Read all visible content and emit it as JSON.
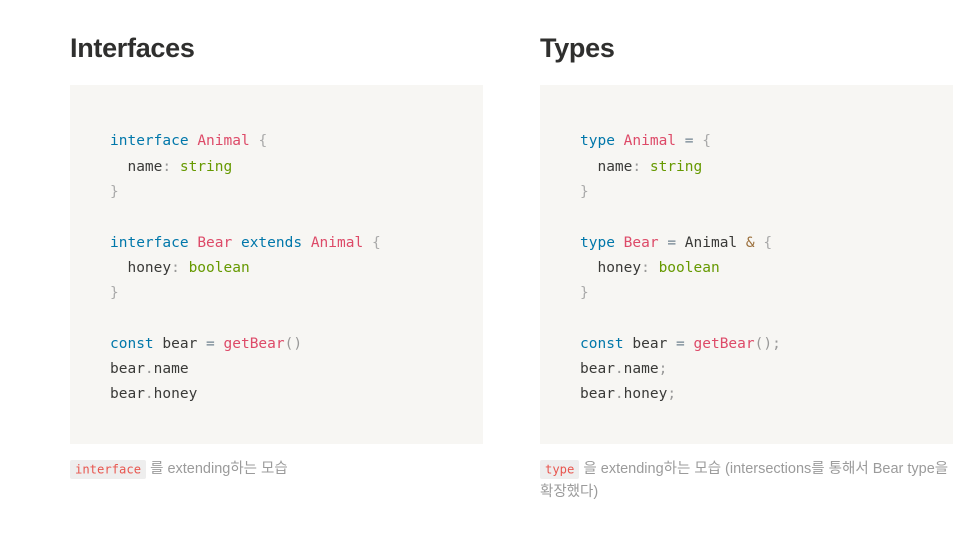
{
  "page": {
    "background": "#ffffff",
    "code_block_background": "#f7f6f3"
  },
  "colors": {
    "heading": "#2f2f2e",
    "keyword": "#0077aa",
    "type_name": "#dd4a68",
    "primitive": "#669900",
    "punctuation": "#999999",
    "operator": "#9a6e3a",
    "plain_text": "#3a3a38",
    "caption_text": "#9b9b9b",
    "chip_background": "#eeeeee",
    "chip_text": "#e8564f"
  },
  "columns": [
    {
      "id": "interfaces",
      "heading": "Interfaces",
      "code_lines": [
        {
          "tokens": [
            {
              "text": "interface",
              "cls": "t-kw"
            },
            {
              "text": " ",
              "cls": "t-plain"
            },
            {
              "text": "Animal",
              "cls": "t-type"
            },
            {
              "text": " ",
              "cls": "t-plain"
            },
            {
              "text": "{",
              "cls": "t-brace"
            }
          ]
        },
        {
          "tokens": [
            {
              "text": "  name",
              "cls": "t-plain"
            },
            {
              "text": ":",
              "cls": "t-punc"
            },
            {
              "text": " ",
              "cls": "t-plain"
            },
            {
              "text": "string",
              "cls": "t-prim"
            }
          ]
        },
        {
          "tokens": [
            {
              "text": "}",
              "cls": "t-brace"
            }
          ]
        },
        {
          "blank": true
        },
        {
          "tokens": [
            {
              "text": "interface",
              "cls": "t-kw"
            },
            {
              "text": " ",
              "cls": "t-plain"
            },
            {
              "text": "Bear",
              "cls": "t-type"
            },
            {
              "text": " ",
              "cls": "t-plain"
            },
            {
              "text": "extends",
              "cls": "t-kw"
            },
            {
              "text": " ",
              "cls": "t-plain"
            },
            {
              "text": "Animal",
              "cls": "t-type"
            },
            {
              "text": " ",
              "cls": "t-plain"
            },
            {
              "text": "{",
              "cls": "t-brace"
            }
          ]
        },
        {
          "tokens": [
            {
              "text": "  honey",
              "cls": "t-plain"
            },
            {
              "text": ":",
              "cls": "t-punc"
            },
            {
              "text": " ",
              "cls": "t-plain"
            },
            {
              "text": "boolean",
              "cls": "t-prim"
            }
          ]
        },
        {
          "tokens": [
            {
              "text": "}",
              "cls": "t-brace"
            }
          ]
        },
        {
          "blank": true
        },
        {
          "tokens": [
            {
              "text": "const",
              "cls": "t-kw"
            },
            {
              "text": " bear ",
              "cls": "t-plain"
            },
            {
              "text": "=",
              "cls": "t-eq"
            },
            {
              "text": " ",
              "cls": "t-plain"
            },
            {
              "text": "getBear",
              "cls": "t-fn"
            },
            {
              "text": "()",
              "cls": "t-punc"
            }
          ]
        },
        {
          "tokens": [
            {
              "text": "bear",
              "cls": "t-plain"
            },
            {
              "text": ".",
              "cls": "t-punc"
            },
            {
              "text": "name",
              "cls": "t-plain"
            }
          ]
        },
        {
          "tokens": [
            {
              "text": "bear",
              "cls": "t-plain"
            },
            {
              "text": ".",
              "cls": "t-punc"
            },
            {
              "text": "honey",
              "cls": "t-plain"
            }
          ]
        }
      ],
      "caption": {
        "chip": "interface",
        "text": " 를 extending하는 모습"
      }
    },
    {
      "id": "types",
      "heading": "Types",
      "code_lines": [
        {
          "tokens": [
            {
              "text": "type",
              "cls": "t-kw"
            },
            {
              "text": " ",
              "cls": "t-plain"
            },
            {
              "text": "Animal",
              "cls": "t-type"
            },
            {
              "text": " ",
              "cls": "t-plain"
            },
            {
              "text": "=",
              "cls": "t-eq"
            },
            {
              "text": " ",
              "cls": "t-plain"
            },
            {
              "text": "{",
              "cls": "t-brace"
            }
          ]
        },
        {
          "tokens": [
            {
              "text": "  name",
              "cls": "t-plain"
            },
            {
              "text": ":",
              "cls": "t-punc"
            },
            {
              "text": " ",
              "cls": "t-plain"
            },
            {
              "text": "string",
              "cls": "t-prim"
            }
          ]
        },
        {
          "tokens": [
            {
              "text": "}",
              "cls": "t-brace"
            }
          ]
        },
        {
          "blank": true
        },
        {
          "tokens": [
            {
              "text": "type",
              "cls": "t-kw"
            },
            {
              "text": " ",
              "cls": "t-plain"
            },
            {
              "text": "Bear",
              "cls": "t-type"
            },
            {
              "text": " ",
              "cls": "t-plain"
            },
            {
              "text": "=",
              "cls": "t-eq"
            },
            {
              "text": " Animal ",
              "cls": "t-plain"
            },
            {
              "text": "&",
              "cls": "t-op"
            },
            {
              "text": " ",
              "cls": "t-plain"
            },
            {
              "text": "{",
              "cls": "t-brace"
            }
          ]
        },
        {
          "tokens": [
            {
              "text": "  honey",
              "cls": "t-plain"
            },
            {
              "text": ":",
              "cls": "t-punc"
            },
            {
              "text": " ",
              "cls": "t-plain"
            },
            {
              "text": "boolean",
              "cls": "t-prim"
            }
          ]
        },
        {
          "tokens": [
            {
              "text": "}",
              "cls": "t-brace"
            }
          ]
        },
        {
          "blank": true
        },
        {
          "tokens": [
            {
              "text": "const",
              "cls": "t-kw"
            },
            {
              "text": " bear ",
              "cls": "t-plain"
            },
            {
              "text": "=",
              "cls": "t-eq"
            },
            {
              "text": " ",
              "cls": "t-plain"
            },
            {
              "text": "getBear",
              "cls": "t-fn"
            },
            {
              "text": "();",
              "cls": "t-punc"
            }
          ]
        },
        {
          "tokens": [
            {
              "text": "bear",
              "cls": "t-plain"
            },
            {
              "text": ".",
              "cls": "t-punc"
            },
            {
              "text": "name",
              "cls": "t-plain"
            },
            {
              "text": ";",
              "cls": "t-punc"
            }
          ]
        },
        {
          "tokens": [
            {
              "text": "bear",
              "cls": "t-plain"
            },
            {
              "text": ".",
              "cls": "t-punc"
            },
            {
              "text": "honey",
              "cls": "t-plain"
            },
            {
              "text": ";",
              "cls": "t-punc"
            }
          ]
        }
      ],
      "caption": {
        "chip": "type",
        "text": " 을 extending하는 모습 (intersections를 통해서 Bear type을 확장했다)"
      }
    }
  ]
}
